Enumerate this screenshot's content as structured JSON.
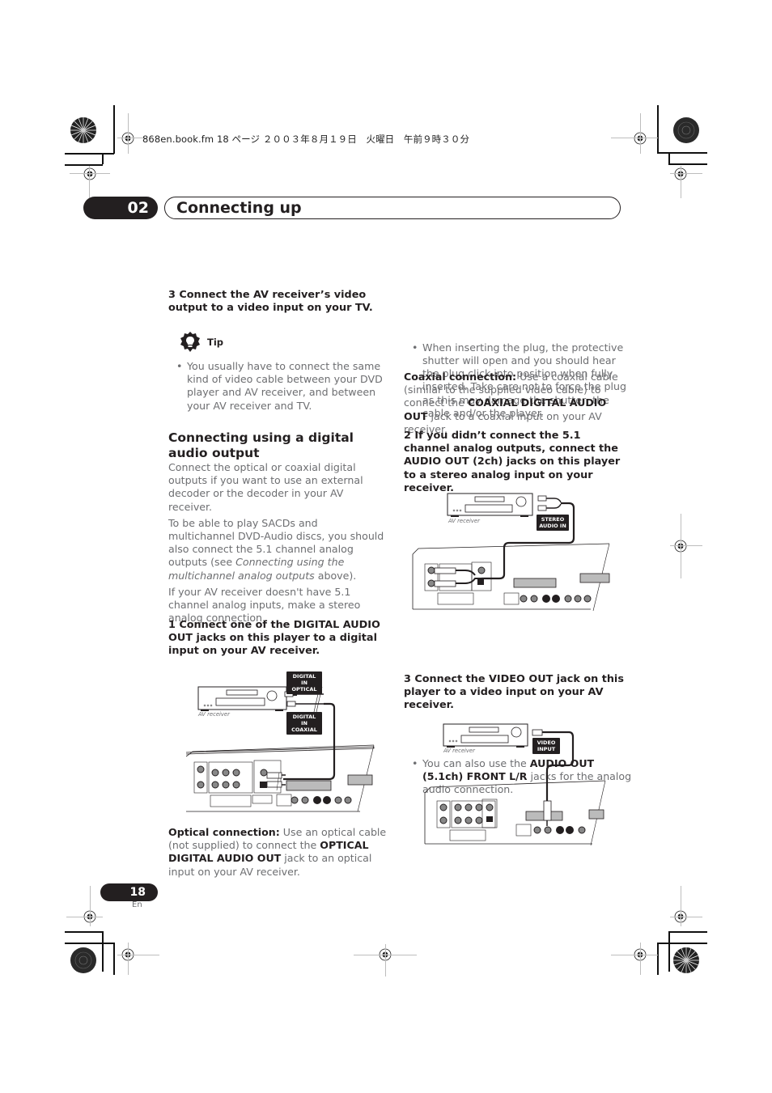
{
  "print_header": {
    "file_info": "868en.book.fm  18 ページ  ２００３年８月１９日　火曜日　午前９時３０分"
  },
  "chapter": {
    "number": "02",
    "title": "Connecting up"
  },
  "left_column": {
    "step3_av": "3    Connect the AV receiver’s video output to a video input on your TV.",
    "tip_label": "Tip",
    "tip_bullet": "You usually have to connect the same kind of video cable between your DVD player and AV receiver, and between your AV receiver and TV.",
    "section_heading": "Connecting using a digital audio output",
    "para1": "Connect the optical or coaxial digital outputs if you want to use an external decoder or the decoder in your AV receiver.",
    "para2_prefix": "To be able to play SACDs and multichannel DVD-Audio discs, you should also connect the 5.1 channel analog outputs (see ",
    "para2_italic": "Connecting using the multichannel analog outputs",
    "para2_suffix": " above).",
    "para3": "If your AV receiver doesn't have 5.1 channel analog inputs, make a stereo analog connection.",
    "step1": "1    Connect one of the DIGITAL AUDIO OUT jacks on this player to a digital input on your AV receiver.",
    "diagram1": {
      "tag_optical": "DIGITAL IN OPTICAL",
      "tag_coaxial": "DIGITAL IN COAXIAL",
      "av_receiver_label": "AV receiver"
    },
    "optical_label": "Optical connection:",
    "optical_text1": " Use an optical cable (not supplied) to connect the ",
    "optical_bold": "OPTICAL DIGITAL AUDIO OUT",
    "optical_text2": " jack to an optical input on your AV receiver."
  },
  "right_column": {
    "bullet_plug": "When inserting the plug, the protective shutter will open and you should hear the plug click into position when fully inserted. Take care not to force the plug as this may damage the shutter, the cable and/or the player.",
    "coaxial_label": "Coaxial connection:",
    "coaxial_text1": " Use a coaxial cable (similar to the supplied video cable) to connect the ",
    "coaxial_bold": "COAXIAL DIGITAL AUDIO OUT",
    "coaxial_text2": " jack to a coaxial input on your AV receiver.",
    "step2": "2    If you didn’t connect the 5.1 channel analog outputs, connect the AUDIO OUT (2ch) jacks on this player to a stereo analog input on your receiver.",
    "diagram2": {
      "tag_stereo": "STEREO AUDIO IN",
      "av_receiver_label": "AV receiver"
    },
    "bullet_51_prefix": "You can also use the ",
    "bullet_51_bold": "AUDIO OUT (5.1ch) FRONT L/R",
    "bullet_51_suffix": " jacks for the analog audio connection.",
    "step3_video": "3    Connect the VIDEO OUT jack on this player to a video input on your AV receiver.",
    "diagram3": {
      "tag_video": "VIDEO INPUT",
      "av_receiver_label": "AV receiver"
    }
  },
  "footer": {
    "page_number": "18",
    "language": "En"
  }
}
